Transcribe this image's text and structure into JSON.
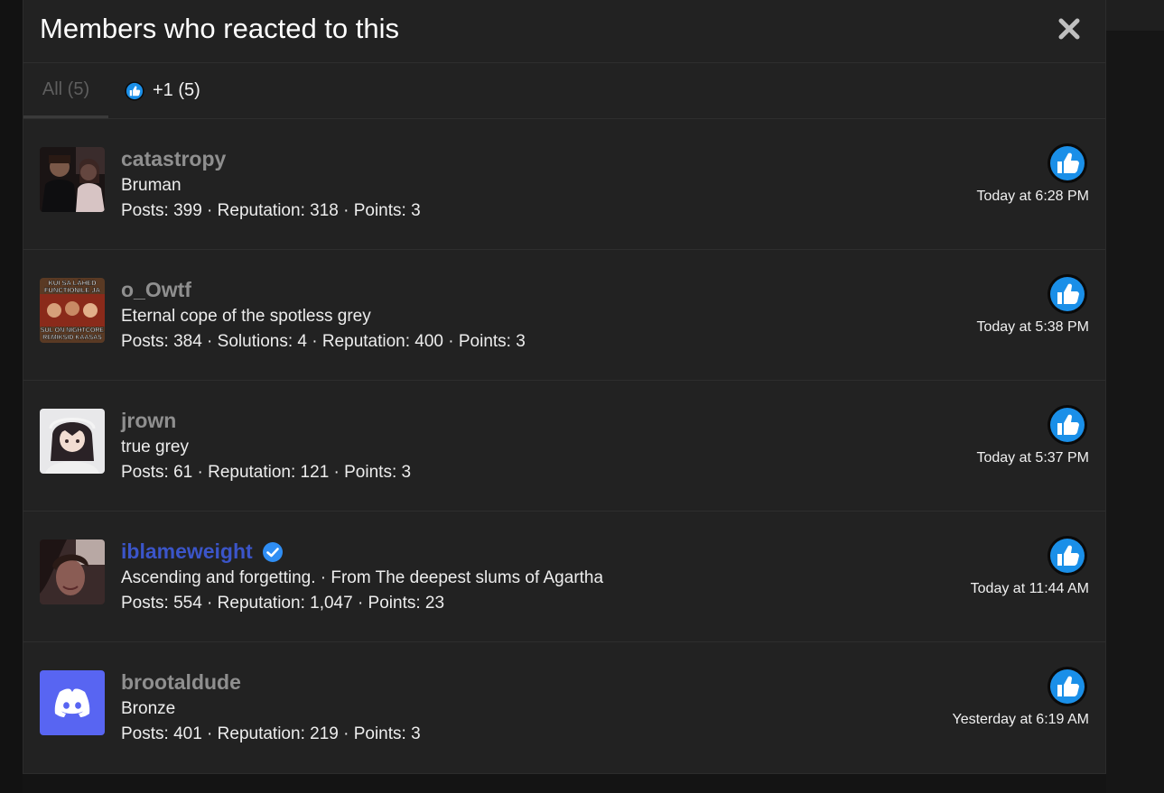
{
  "modal": {
    "title": "Members who reacted to this",
    "close_icon": "close-icon"
  },
  "tabs": [
    {
      "label": "All (5)",
      "active": true
    },
    {
      "label": "+1 (5)",
      "icon": "thumbs-up-icon",
      "active": false
    }
  ],
  "colors": {
    "accent_like": "#1a8fe8",
    "verified_name": "#3b55c9",
    "verified_badge": "#2f8ef4",
    "modal_bg": "#222222"
  },
  "reactions": [
    {
      "username": "catastropy",
      "verified": false,
      "title": "Bruman",
      "stats": "Posts: 399 · Reputation: 318 · Points: 3",
      "timestamp": "Today at 6:28 PM",
      "reaction_icon": "thumbs-up-icon",
      "avatar": "photo-avatar"
    },
    {
      "username": "o_Owtf",
      "verified": false,
      "title": "Eternal cope of the spotless grey",
      "stats": "Posts: 384 · Solutions: 4 · Reputation: 400 · Points: 3",
      "timestamp": "Today at 5:38 PM",
      "reaction_icon": "thumbs-up-icon",
      "avatar": "meme-avatar",
      "avatar_text": [
        "KUI SA LÄHED",
        "FUNCTIONILE JA",
        "SUL ON NIGHTCORE",
        "REMIKSID KAASAS"
      ]
    },
    {
      "username": "jrown",
      "verified": false,
      "title": "true grey",
      "stats": "Posts: 61 · Reputation: 121 · Points: 3",
      "timestamp": "Today at 5:37 PM",
      "reaction_icon": "thumbs-up-icon",
      "avatar": "anime-avatar"
    },
    {
      "username": "iblameweight",
      "verified": true,
      "title": "Ascending and forgetting. · From The deepest slums of Agartha",
      "stats": "Posts: 554 · Reputation: 1,047 · Points: 23",
      "timestamp": "Today at 11:44 AM",
      "reaction_icon": "thumbs-up-icon",
      "avatar": "photo-avatar"
    },
    {
      "username": "brootaldude",
      "verified": false,
      "title": "Bronze",
      "stats": "Posts: 401 · Reputation: 219 · Points: 3",
      "timestamp": "Yesterday at 6:19 AM",
      "reaction_icon": "thumbs-up-icon",
      "avatar": "discord-avatar"
    }
  ]
}
